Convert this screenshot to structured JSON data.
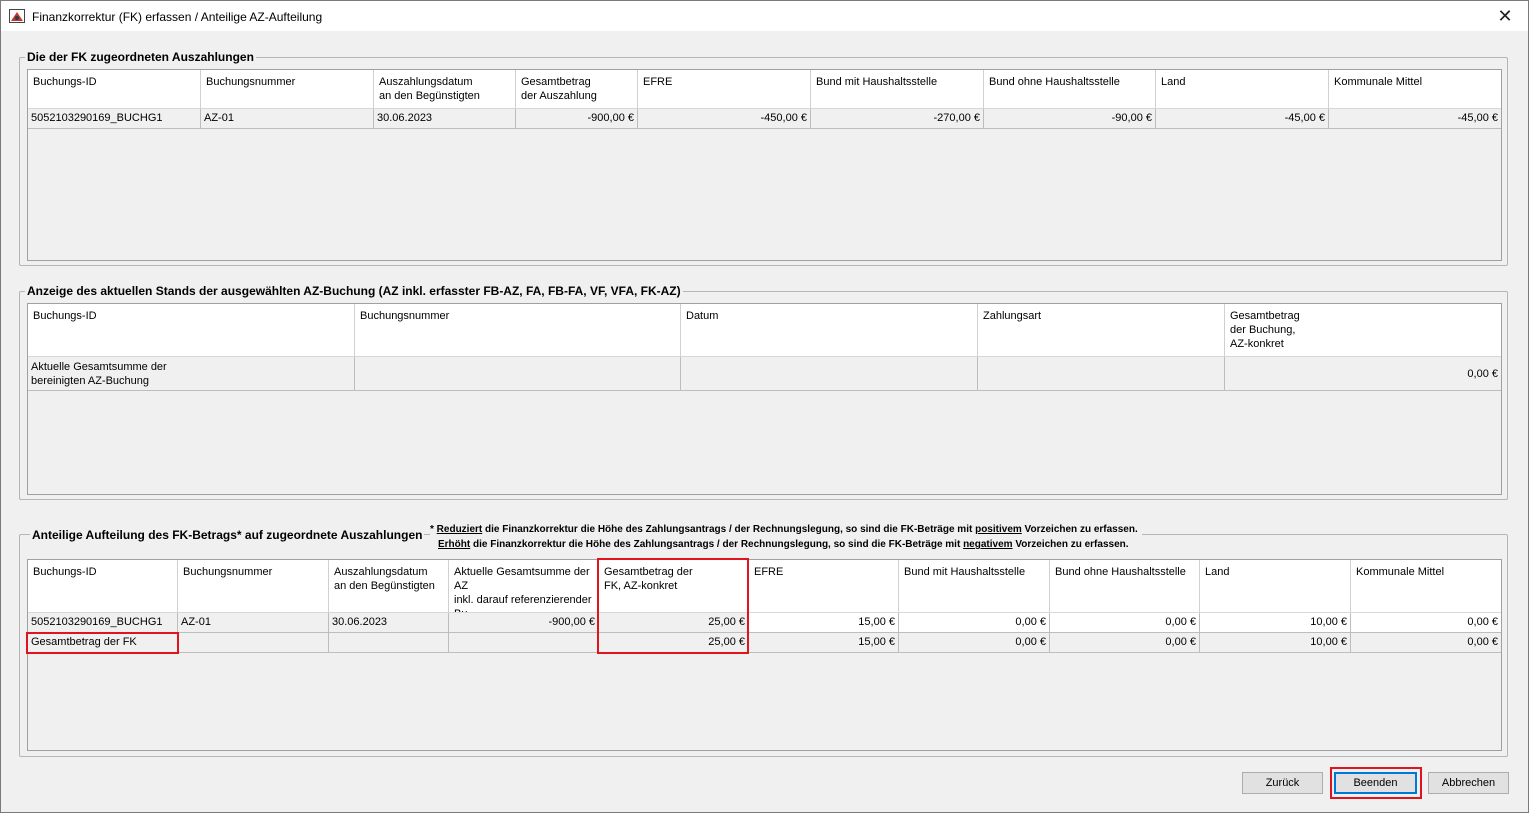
{
  "window": {
    "title": "Finanzkorrektur (FK) erfassen / Anteilige AZ-Aufteilung",
    "close_glyph": "✕"
  },
  "section1": {
    "title": "Die der FK zugeordneten Auszahlungen",
    "headers": [
      "Buchungs-ID",
      "Buchungsnummer",
      "Auszahlungsdatum\nan den Begünstigten",
      "Gesamtbetrag\nder Auszahlung",
      "EFRE",
      "Bund mit Haushaltsstelle",
      "Bund ohne Haushaltsstelle",
      "Land",
      "Kommunale Mittel"
    ],
    "rows": [
      [
        "5052103290169_BUCHG1",
        "AZ-01",
        "30.06.2023",
        "-900,00 €",
        "-450,00 €",
        "-270,00 €",
        "-90,00 €",
        "-45,00 €",
        "-45,00 €"
      ]
    ]
  },
  "section2": {
    "title": "Anzeige des aktuellen Stands der ausgewählten AZ-Buchung (AZ inkl. erfasster FB-AZ, FA, FB-FA, VF, VFA, FK-AZ)",
    "headers": [
      "Buchungs-ID",
      "Buchungsnummer",
      "Datum",
      "Zahlungsart",
      "Gesamtbetrag\nder Buchung,\nAZ-konkret"
    ],
    "rows": [
      [
        "Aktuelle Gesamtsumme der\nbereinigten AZ-Buchung",
        "",
        "",
        "",
        "0,00 €"
      ]
    ]
  },
  "section3": {
    "title": "Anteilige Aufteilung des FK-Betrags* auf zugeordnete Auszahlungen",
    "note": {
      "line1_prefix": "* ",
      "line1_u1": "Reduziert",
      "line1_mid": " die Finanzkorrektur die Höhe des Zahlungsantrags / der Rechnungslegung, so sind die FK-Beträge mit ",
      "line1_u2": "positivem",
      "line1_suffix": " Vorzeichen zu erfassen.",
      "line2_u1": "Erhöht",
      "line2_mid": " die Finanzkorrektur die Höhe des Zahlungsantrags / der Rechnungslegung, so sind die FK-Beträge mit ",
      "line2_u2": "negativem",
      "line2_suffix": " Vorzeichen zu erfassen."
    },
    "headers": [
      "Buchungs-ID",
      "Buchungsnummer",
      "Auszahlungsdatum\nan den Begünstigten",
      "Aktuelle Gesamtsumme der\nAZ\ninkl. darauf referenzierender\nBu",
      "Gesamtbetrag der\nFK, AZ-konkret",
      "EFRE",
      "Bund mit Haushaltsstelle",
      "Bund ohne Haushaltsstelle",
      "Land",
      "Kommunale Mittel"
    ],
    "rows": [
      [
        "5052103290169_BUCHG1",
        "AZ-01",
        "30.06.2023",
        "-900,00 €",
        "25,00 €",
        "15,00 €",
        "0,00 €",
        "0,00 €",
        "10,00 €",
        "0,00 €"
      ],
      [
        "Gesamtbetrag der FK",
        "",
        "",
        "",
        "25,00 €",
        "15,00 €",
        "0,00 €",
        "0,00 €",
        "10,00 €",
        "0,00 €"
      ]
    ]
  },
  "buttons": {
    "back": "Zurück",
    "finish": "Beenden",
    "cancel": "Abbrechen"
  },
  "colors": {
    "highlight": "#e0141e",
    "focus": "#0078d7"
  }
}
